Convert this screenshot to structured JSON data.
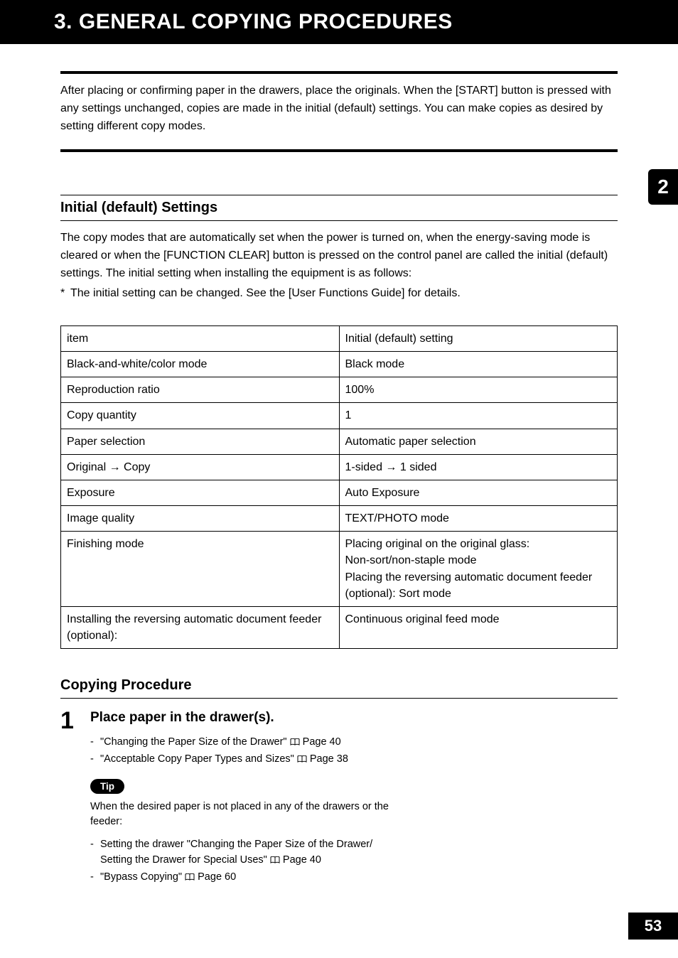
{
  "header": {
    "title": "3. GENERAL COPYING PROCEDURES"
  },
  "intro": "After placing or confirming paper in the drawers, place the originals. When the [START] button is pressed with any settings unchanged, copies are made in the initial (default) settings. You can make copies as desired by setting different copy modes.",
  "section1": {
    "heading": "Initial (default) Settings",
    "body": "The copy modes that are automatically set when the power is turned on, when the energy-saving mode is cleared or when the [FUNCTION CLEAR] button is pressed on the control panel are called the initial (default) settings. The initial setting when installing the equipment is as follows:",
    "footnote": "The initial setting can be changed. See the [User Functions Guide] for details."
  },
  "table": {
    "header": {
      "col1": "item",
      "col2": "Initial (default) setting"
    },
    "rows": [
      {
        "item": "Black-and-white/color mode",
        "setting": "Black mode"
      },
      {
        "item": "Reproduction ratio",
        "setting": "100%"
      },
      {
        "item": "Copy quantity",
        "setting": "1"
      },
      {
        "item": "Paper selection",
        "setting": "Automatic paper selection"
      },
      {
        "item": "Original → Copy",
        "setting": "1-sided → 1 sided"
      },
      {
        "item": "Exposure",
        "setting": "Auto Exposure"
      },
      {
        "item": "Image quality",
        "setting": "TEXT/PHOTO mode"
      },
      {
        "item": "Finishing mode",
        "setting": "Placing original on the original glass:\nNon-sort/non-staple mode\nPlacing the reversing automatic document feeder (optional): Sort mode"
      },
      {
        "item": "Installing the reversing automatic document feeder (optional):",
        "setting": "Continuous original feed mode"
      }
    ]
  },
  "section2": {
    "heading": "Copying Procedure",
    "step1": {
      "number": "1",
      "title": "Place paper in the drawer(s).",
      "refs": [
        {
          "text": "\"Changing the Paper Size of the Drawer\"",
          "page": "Page 40"
        },
        {
          "text": "\"Acceptable Copy Paper Types and Sizes\"",
          "page": "Page 38"
        }
      ],
      "tip_label": "Tip",
      "tip_body": "When the desired paper is not placed in any of the drawers or the feeder:",
      "tip_refs": [
        {
          "text": "Setting the drawer \"Changing the Paper Size of the Drawer/\nSetting the Drawer for Special Uses\"",
          "page": "Page 40"
        },
        {
          "text": "\"Bypass Copying\"",
          "page": "Page 60"
        }
      ]
    }
  },
  "chapter_tab": "2",
  "page_number": "53"
}
